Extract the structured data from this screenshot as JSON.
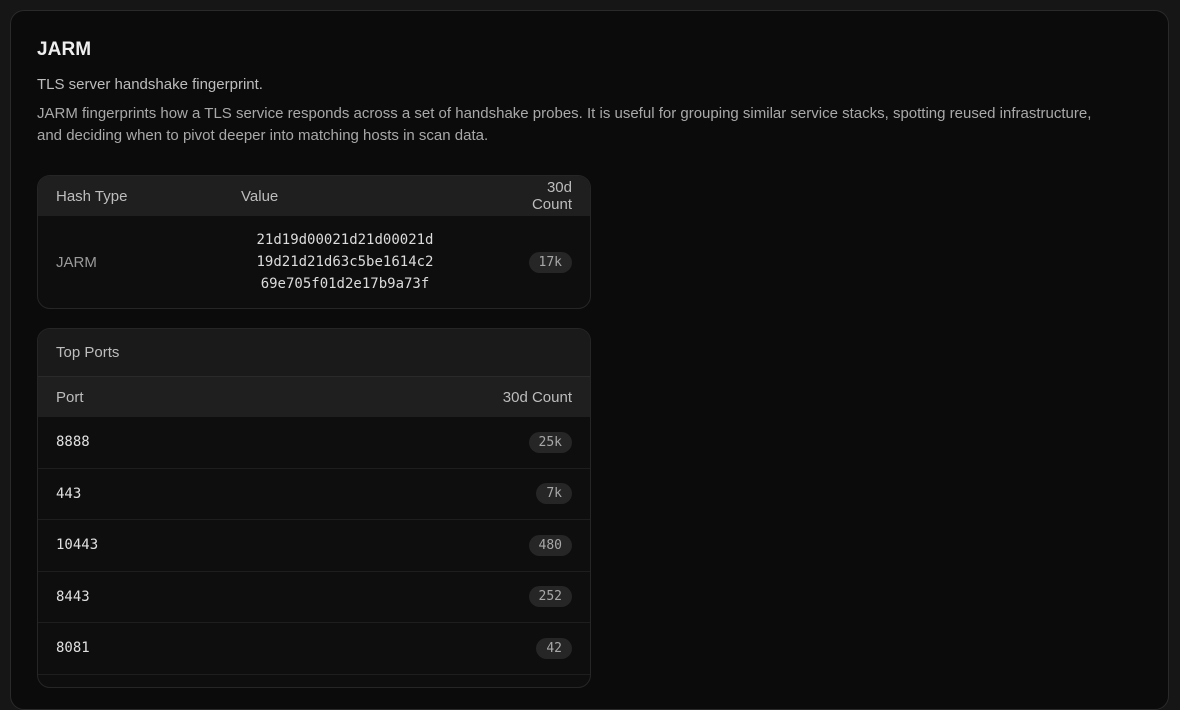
{
  "header": {
    "title": "JARM",
    "subtitle": "TLS server handshake fingerprint.",
    "description": "JARM fingerprints how a TLS service responds across a set of handshake probes. It is useful for grouping similar service stacks, spotting reused infrastructure, and deciding when to pivot deeper into matching hosts in scan data."
  },
  "hash_table": {
    "columns": [
      "Hash Type",
      "Value",
      "30d Count"
    ],
    "row": {
      "type": "JARM",
      "value_lines": [
        "21d19d00021d21d00021d",
        "19d21d21d63c5be1614c2",
        "69e705f01d2e17b9a73f"
      ],
      "count": "17k"
    }
  },
  "top_ports": {
    "title": "Top Ports",
    "columns": [
      "Port",
      "30d Count"
    ],
    "rows": [
      {
        "port": "8888",
        "count": "25k"
      },
      {
        "port": "443",
        "count": "7k"
      },
      {
        "port": "10443",
        "count": "480"
      },
      {
        "port": "8443",
        "count": "252"
      },
      {
        "port": "8081",
        "count": "42"
      }
    ]
  }
}
